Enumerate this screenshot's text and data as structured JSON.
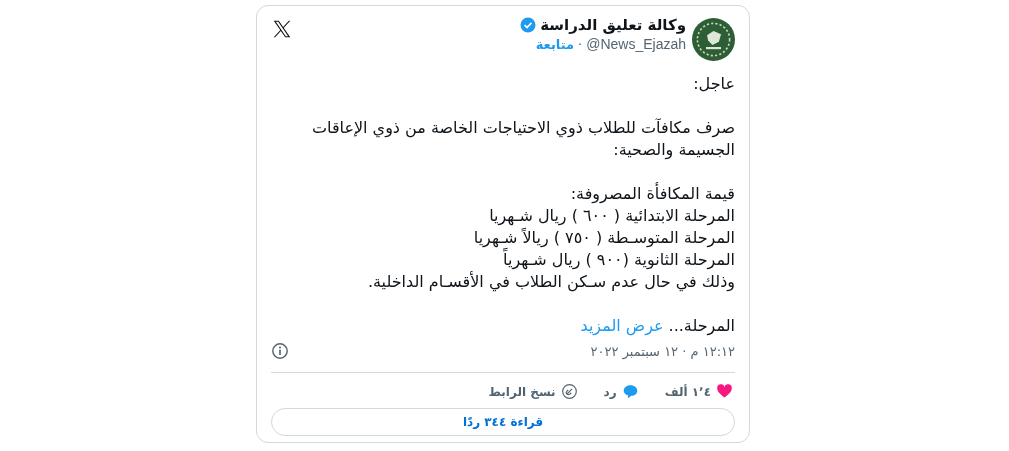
{
  "author": {
    "name": "وكالة تعليق الدراسة",
    "verified": true,
    "handle": "@News_Ejazah",
    "separator": "·",
    "follow": "متابعة"
  },
  "body": [
    {
      "lines": [
        "عاجل:"
      ]
    },
    {
      "lines": [
        "صرف مكافآت للطلاب ذوي الاحتياجات الخاصة من ذوي الإعاقات الجسيمة والصحية:"
      ]
    },
    {
      "lines": [
        "قيمة المكافأة المصروفة:",
        "المرحلة الابتدائية ( ٦٠٠ ) ريال شـهريا",
        "المرحلة المتوسـطة ( ٧٥٠ ) ريالاً شـهريا",
        "المرحلة الثانوية (٩٠٠ ) ريال شـهرياً",
        "وذلك في حال عدم سـكن الطلاب في الأقسـام الداخلية."
      ]
    },
    {
      "lines": [
        "المرحلة..."
      ],
      "more": "عرض المزيد"
    }
  ],
  "timestamp": "١٢:١٢ م · ١٢ سبتمبر ٢٠٢٢",
  "actions": [
    {
      "kind": "like",
      "label": "١٬٤ ألف"
    },
    {
      "kind": "reply",
      "label": "رد"
    },
    {
      "kind": "copy",
      "label": "نسخ الرابط"
    }
  ],
  "replies_button": "قراءة ٣٤٤ ردًا"
}
